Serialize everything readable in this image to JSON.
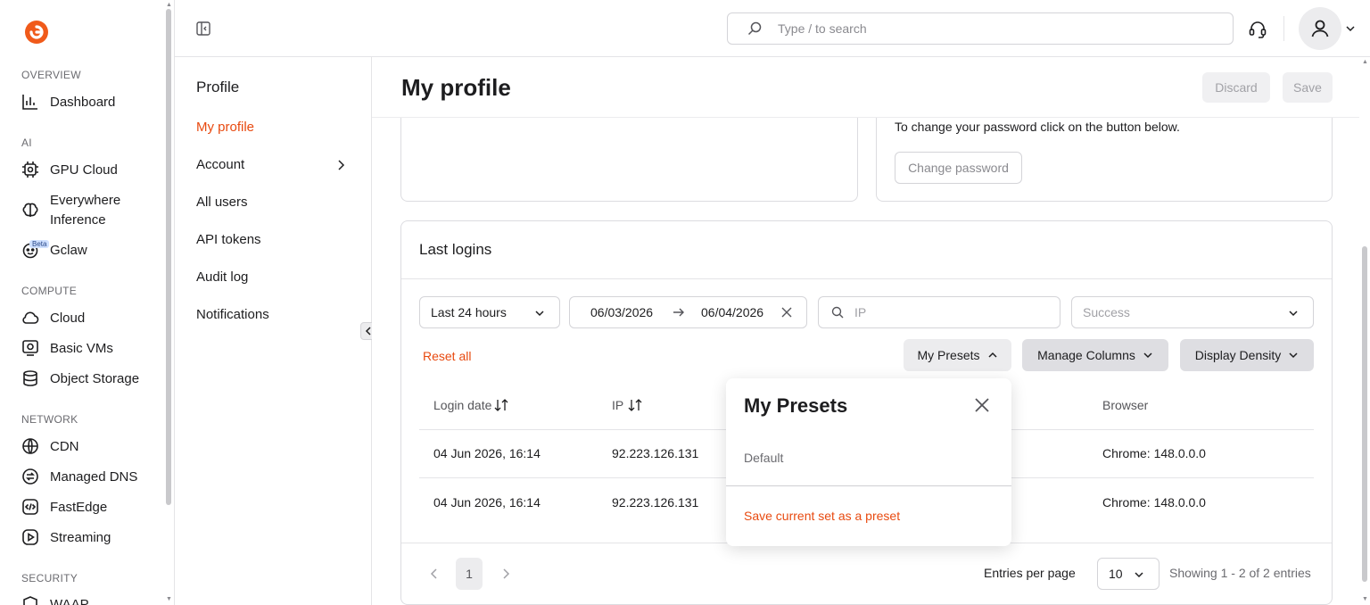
{
  "nav": {
    "sections": {
      "overview": "OVERVIEW",
      "ai": "AI",
      "compute": "COMPUTE",
      "network": "NETWORK",
      "security": "SECURITY"
    },
    "items": {
      "dashboard": "Dashboard",
      "gpu_cloud": "GPU Cloud",
      "everywhere_inference_1": "Everywhere",
      "everywhere_inference_2": "Inference",
      "gclaw": "Gclaw",
      "gclaw_badge": "Beta",
      "cloud": "Cloud",
      "basic_vms": "Basic VMs",
      "object_storage": "Object Storage",
      "cdn": "CDN",
      "managed_dns": "Managed DNS",
      "fastedge": "FastEdge",
      "streaming": "Streaming",
      "waap": "WAAP"
    }
  },
  "subnav": {
    "title": "Profile",
    "items": [
      "My profile",
      "Account",
      "All users",
      "API tokens",
      "Audit log",
      "Notifications"
    ]
  },
  "header": {
    "search_placeholder": "Type / to search"
  },
  "page": {
    "title": "My profile",
    "discard": "Discard",
    "save": "Save",
    "password_text": "To change your password click on the button below.",
    "change_password": "Change password"
  },
  "logins": {
    "title": "Last logins",
    "period": "Last 24 hours",
    "date_from": "06/03/2026",
    "date_to": "06/04/2026",
    "ip_placeholder": "IP",
    "status_placeholder": "Success",
    "reset_all": "Reset all",
    "presets_btn": "My Presets",
    "manage_columns": "Manage Columns",
    "display_density": "Display Density",
    "columns": {
      "login_date": "Login date",
      "ip": "IP",
      "browser": "Browser"
    },
    "rows": [
      {
        "date": "04 Jun 2026, 16:14",
        "ip": "92.223.126.131",
        "browser": "Chrome: 148.0.0.0"
      },
      {
        "date": "04 Jun 2026, 16:14",
        "ip": "92.223.126.131",
        "browser": "Chrome: 148.0.0.0"
      }
    ],
    "page": "1",
    "entries_label": "Entries per page",
    "entries_value": "10",
    "showing": "Showing 1 - 2 of 2 entries"
  },
  "presets_popover": {
    "title": "My Presets",
    "default": "Default",
    "save_current": "Save current set as a preset"
  },
  "colors": {
    "accent": "#e84a10",
    "border": "#dcdce0",
    "muted": "#8a8a8f"
  }
}
